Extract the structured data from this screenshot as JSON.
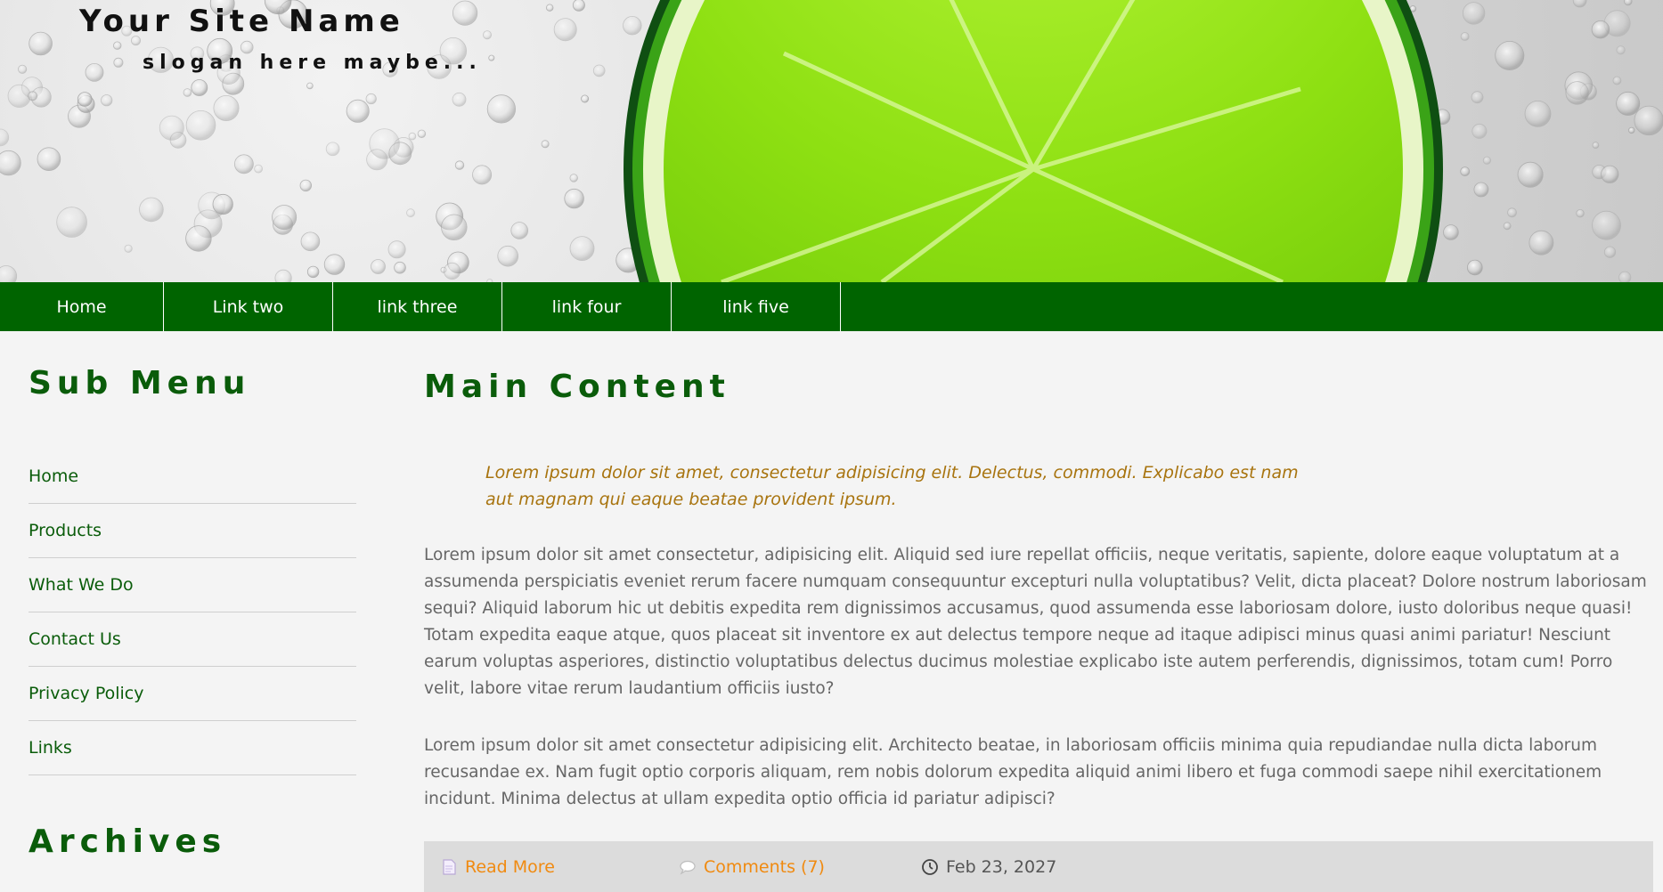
{
  "header": {
    "site_name": "Your Site Name",
    "slogan": "slogan here maybe..."
  },
  "nav": {
    "items": [
      "Home",
      "Link two",
      "link three",
      "link four",
      "link five"
    ]
  },
  "sidebar": {
    "submenu_title": "Sub Menu",
    "items": [
      "Home",
      "Products",
      "What We Do",
      "Contact Us",
      "Privacy Policy",
      "Links"
    ],
    "archives_title": "Archives"
  },
  "main": {
    "title": "Main Content",
    "quote": "Lorem ipsum dolor sit amet, consectetur adipisicing elit. Delectus, commodi. Explicabo est nam aut magnam qui eaque beatae provident ipsum.",
    "paragraph1": "Lorem ipsum dolor sit amet consectetur, adipisicing elit. Aliquid sed iure repellat officiis, neque veritatis, sapiente, dolore eaque voluptatum at a assumenda perspiciatis eveniet rerum facere numquam consequuntur excepturi nulla voluptatibus? Velit, dicta placeat? Dolore nostrum laboriosam sequi? Aliquid laborum hic ut debitis expedita rem dignissimos accusamus, quod assumenda esse laboriosam dolore, iusto doloribus neque quasi! Totam expedita eaque atque, quos placeat sit inventore ex aut delectus tempore neque ad itaque adipisci minus quasi animi pariatur! Nesciunt earum voluptas asperiores, distinctio voluptatibus delectus ducimus molestiae explicabo iste autem perferendis, dignissimos, totam cum! Porro velit, labore vitae rerum laudantium officiis iusto?",
    "paragraph2": "Lorem ipsum dolor sit amet consectetur adipisicing elit. Architecto beatae, in laboriosam officiis minima quia repudiandae nulla dicta laborum recusandae ex. Nam fugit optio corporis aliquam, rem nobis dolorum expedita aliquid animi libero et fuga commodi saepe nihil exercitationem incidunt. Minima delectus at ullam expedita optio officia id pariatur adipisci?",
    "meta": {
      "read_more": "Read More",
      "comments": "Comments (7)",
      "date": "Feb 23, 2027"
    }
  },
  "colors": {
    "nav_bg": "#006400",
    "heading_green": "#0a5c0a",
    "quote_gold": "#a8740f",
    "link_orange": "#f08a10"
  },
  "icons": {
    "read_more": "document-icon",
    "comments": "speech-bubble-icon",
    "date": "clock-icon"
  }
}
